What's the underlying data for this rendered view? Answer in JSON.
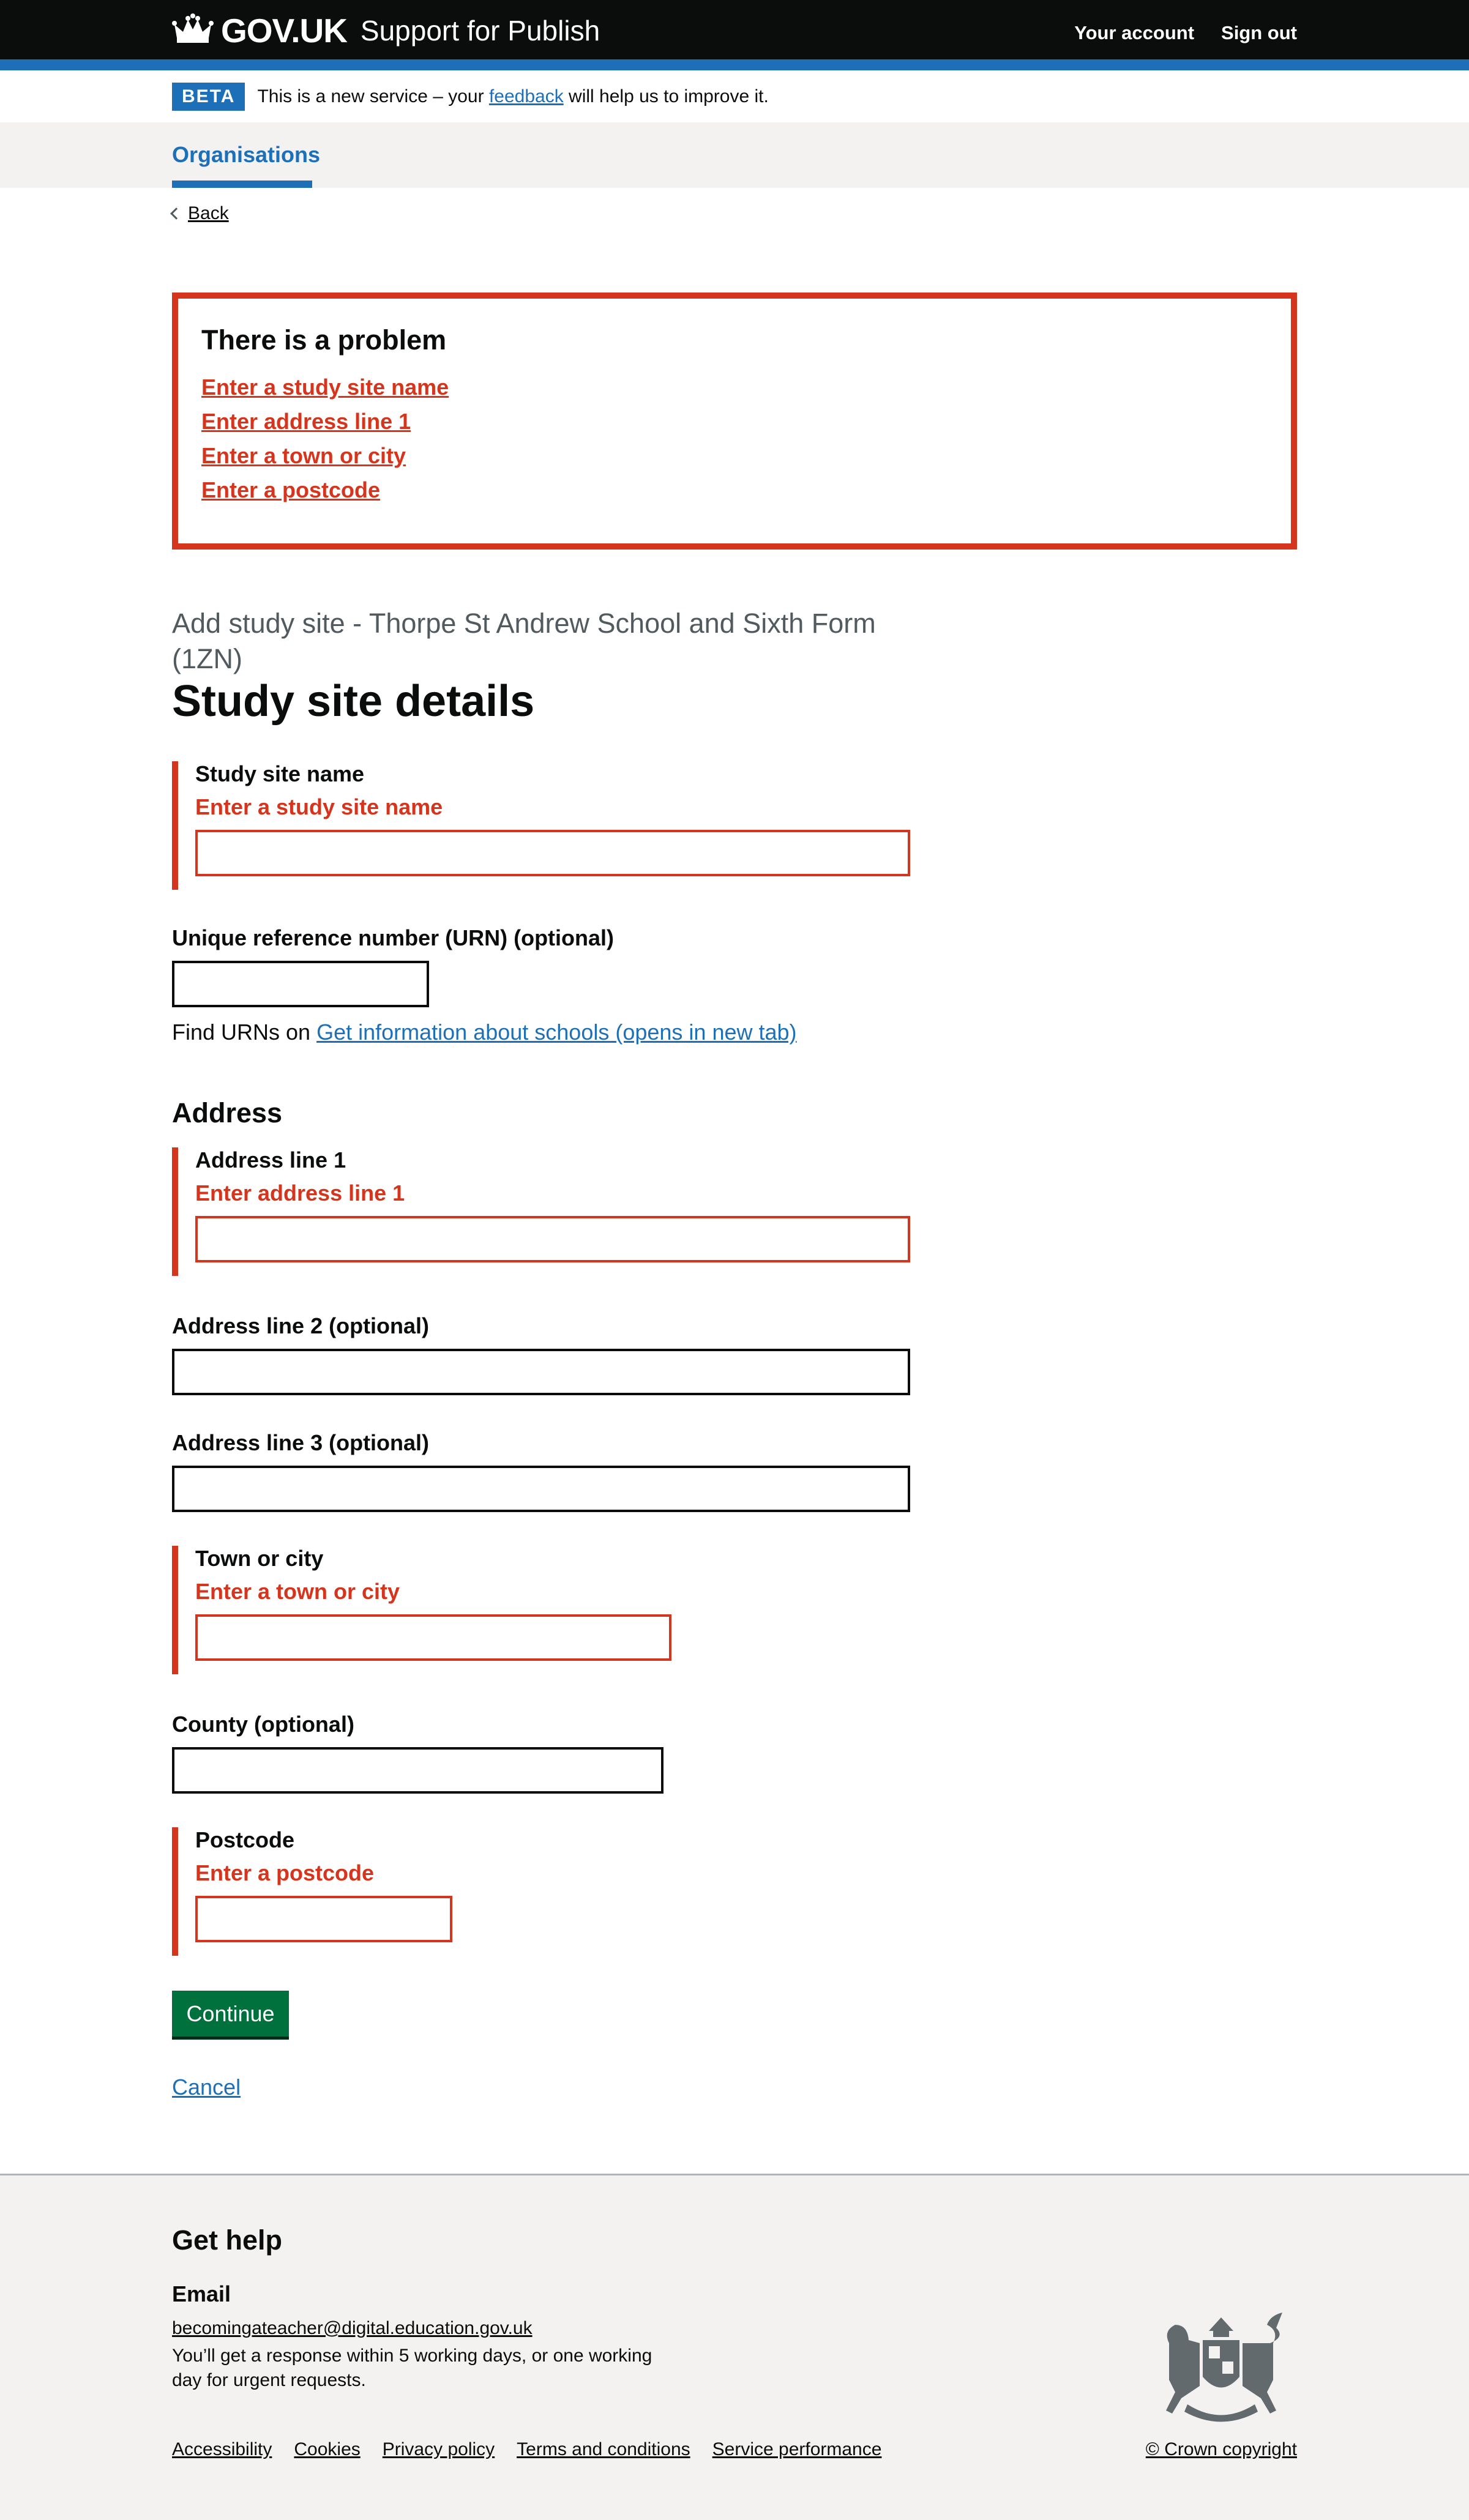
{
  "header": {
    "logo_text": "GOV.UK",
    "service_name": "Support for Publish",
    "nav": [
      "Your account",
      "Sign out"
    ]
  },
  "beta": {
    "tag": "BETA",
    "text_before": "This is a new service – your ",
    "link": "feedback",
    "text_after": " will help us to improve it."
  },
  "subnav": {
    "item": "Organisations"
  },
  "back_link": "Back",
  "error_summary": {
    "title": "There is a problem",
    "errors": [
      "Enter a study site name",
      "Enter address line 1",
      "Enter a town or city",
      "Enter a postcode"
    ]
  },
  "caption": "Add study site - Thorpe St Andrew School and Sixth Form (1ZN)",
  "title": "Study site details",
  "fields": {
    "site_name": {
      "label": "Study site name",
      "error": "Enter a study site name",
      "value": ""
    },
    "urn": {
      "label": "Unique reference number (URN) (optional)",
      "value": ""
    },
    "urn_hint_before": "Find URNs on ",
    "urn_hint_link": "Get information about schools (opens in new tab)",
    "address_heading": "Address",
    "address1": {
      "label": "Address line 1",
      "error": "Enter address line 1",
      "value": ""
    },
    "address2": {
      "label": "Address line 2 (optional)",
      "value": ""
    },
    "address3": {
      "label": "Address line 3 (optional)",
      "value": ""
    },
    "town": {
      "label": "Town or city",
      "error": "Enter a town or city",
      "value": ""
    },
    "county": {
      "label": "County (optional)",
      "value": ""
    },
    "postcode": {
      "label": "Postcode",
      "error": "Enter a postcode",
      "value": ""
    }
  },
  "continue_button": "Continue",
  "cancel_link": "Cancel",
  "footer": {
    "title": "Get help",
    "email_heading": "Email",
    "email": "becomingateacher@digital.education.gov.uk",
    "note": "You’ll get a response within 5 working days, or one working day for urgent requests.",
    "links": [
      "Accessibility",
      "Cookies",
      "Privacy policy",
      "Terms and conditions",
      "Service performance"
    ],
    "copyright": "© Crown copyright"
  },
  "colors": {
    "brand": "#1d70b8",
    "error": "#d4351c",
    "button": "#00703c",
    "header": "#0b0c0c"
  }
}
